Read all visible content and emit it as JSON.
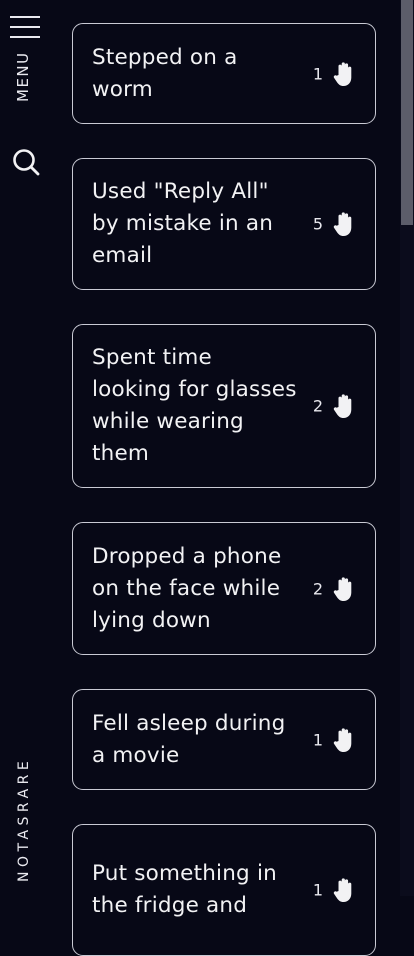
{
  "sidebar": {
    "menu_label": "MENU",
    "brand": "NOTASRARE"
  },
  "icons": {
    "hamburger": "hamburger-icon",
    "search": "search-icon",
    "hand": "raised-hand-icon"
  },
  "colors": {
    "background": "#070816",
    "card_border": "#c9cad4",
    "text": "#f2f2f4"
  },
  "items": [
    {
      "text": "Stepped on a worm",
      "count": "1"
    },
    {
      "text": "Used \"Reply All\" by mistake in an email",
      "count": "5"
    },
    {
      "text": "Spent time looking for glasses while wearing them",
      "count": "2"
    },
    {
      "text": "Dropped a phone on the face while lying down",
      "count": "2"
    },
    {
      "text": "Fell asleep during a movie",
      "count": "1"
    },
    {
      "text": "Put something in the fridge and",
      "count": "1"
    }
  ]
}
